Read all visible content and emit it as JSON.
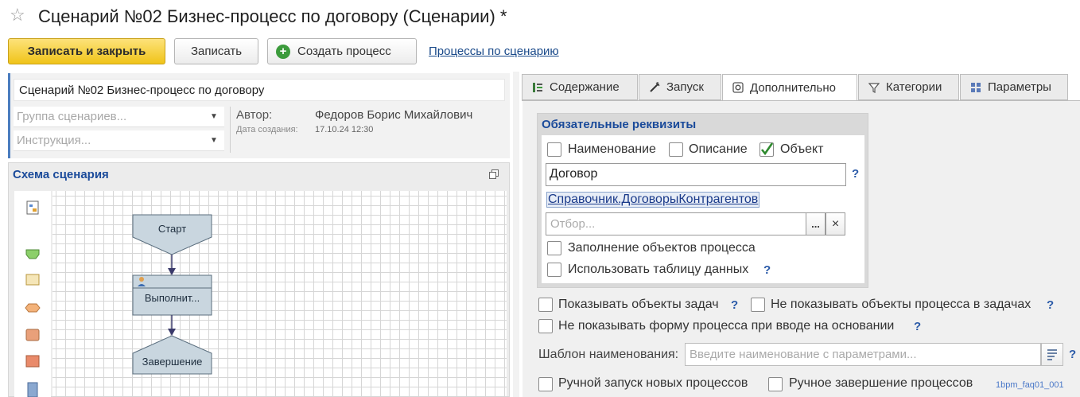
{
  "window": {
    "title": "Сценарий №02 Бизнес-процесс по договору (Сценарии) *"
  },
  "toolbar": {
    "save_close_label": "Записать и закрыть",
    "save_label": "Записать",
    "create_process_label": "Создать процесс",
    "processes_link_label": "Процессы по сценарию"
  },
  "form": {
    "name_value": "Сценарий №02 Бизнес-процесс по договору",
    "group_placeholder": "Группа сценариев...",
    "instruction_placeholder": "Инструкция...",
    "author_label": "Автор:",
    "author_value": "Федоров Борис Михайлович",
    "created_label": "Дата создания:",
    "created_value": "17.10.24 12:30"
  },
  "schema": {
    "title": "Схема сценария",
    "nodes": {
      "start": "Старт",
      "task": "Выполнит...",
      "end": "Завершение"
    }
  },
  "tabs": [
    {
      "label": "Содержание",
      "icon": "content-icon"
    },
    {
      "label": "Запуск",
      "icon": "launch-icon"
    },
    {
      "label": "Дополнительно",
      "icon": "gear-icon",
      "active": true
    },
    {
      "label": "Категории",
      "icon": "filter-icon"
    },
    {
      "label": "Параметры",
      "icon": "parameters-icon"
    }
  ],
  "required": {
    "title": "Обязательные реквизиты",
    "name_label": "Наименование",
    "name_checked": false,
    "description_label": "Описание",
    "description_checked": false,
    "object_label": "Объект",
    "object_checked": true,
    "object_value": "Договор",
    "object_type": "Справочник.ДоговорыКонтрагентов",
    "filter_placeholder": "Отбор...",
    "ellipsis_label": "...",
    "clear_label": "×",
    "fill_objects_label": "Заполнение объектов процесса",
    "use_table_label": "Использовать таблицу данных"
  },
  "options": {
    "show_task_objects": "Показывать объекты задач",
    "hide_process_objects": "Не показывать объекты процесса в задачах",
    "hide_form_on_basis": "Не показывать форму процесса при вводе на основании",
    "name_template_label": "Шаблон наименования:",
    "name_template_placeholder": "Введите наименование с параметрами...",
    "manual_start": "Ручной запуск новых процессов",
    "manual_finish": "Ручное завершение процессов"
  },
  "help_mark": "?",
  "watermark": "1bpm_faq01_001",
  "colors": {
    "accent_yellow": "#f0c419",
    "arrow_red": "#e02020",
    "link_blue": "#1a4a8a",
    "node_fill": "#c9d6df"
  }
}
